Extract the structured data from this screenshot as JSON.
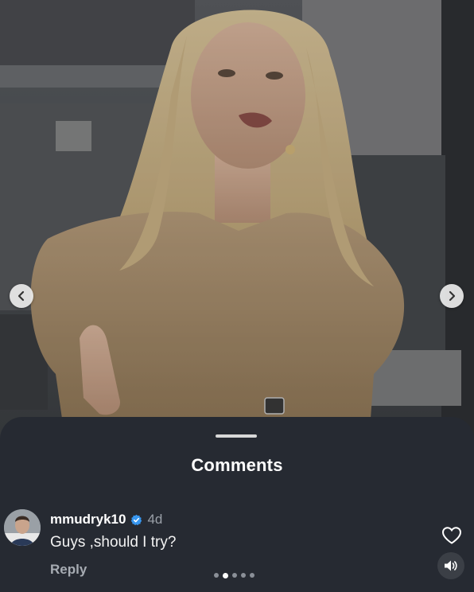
{
  "media": {
    "image_semantic": "video-frame-woman-in-kitchen"
  },
  "navigation": {
    "prev_icon": "chevron-left-icon",
    "next_icon": "chevron-right-icon"
  },
  "comments_sheet": {
    "title": "Comments",
    "comments": [
      {
        "username": "mmudryk10",
        "verified": true,
        "time": "4d",
        "text": "Guys ,should I try?",
        "reply_label": "Reply",
        "like_icon": "heart-icon"
      }
    ]
  },
  "controls": {
    "sound_icon": "speaker-icon"
  },
  "pagination": {
    "count": 5,
    "active_index": 1
  },
  "colors": {
    "sheet_bg": "#262a32",
    "verified_blue": "#3897f0",
    "muted_text": "#9aa0a8"
  }
}
